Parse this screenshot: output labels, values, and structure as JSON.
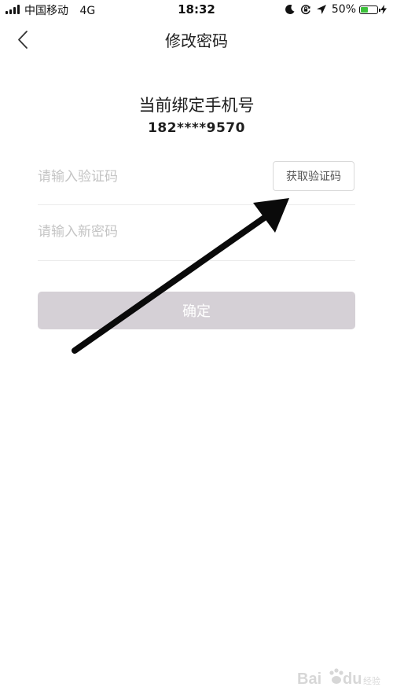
{
  "status_bar": {
    "carrier": "中国移动",
    "network": "4G",
    "time": "18:32",
    "battery_percent": "50%",
    "battery_level": 0.5,
    "battery_color": "#3cc13b"
  },
  "nav": {
    "title": "修改密码",
    "back_icon": "chevron-left-icon"
  },
  "phone": {
    "label": "当前绑定手机号",
    "number": "182****9570"
  },
  "form": {
    "code_placeholder": "请输入验证码",
    "get_code_label": "获取验证码",
    "password_placeholder": "请输入新密码",
    "confirm_label": "确定",
    "confirm_color": "#d5d0d6"
  },
  "annotation": {
    "arrow_icon": "arrow-icon"
  },
  "watermark": {
    "logo": "baidu-jingyan-logo",
    "text": "Bai du 经验"
  }
}
